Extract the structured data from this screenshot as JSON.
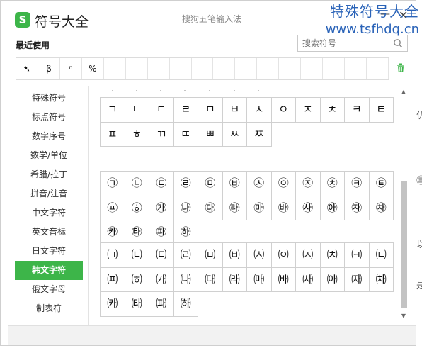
{
  "app": {
    "logo_letter": "S",
    "title": "符号大全",
    "ime_name": "搜狗五笔输入法",
    "minimize": "—",
    "close": "✕"
  },
  "watermark": {
    "title": "特殊符号大全",
    "url": "www.tsfhdq.cn"
  },
  "recent": {
    "label": "最近使用",
    "items": [
      "➷",
      "β",
      "ⁿ",
      "%",
      "",
      "",
      "",
      "",
      "",
      "",
      "",
      "",
      "",
      "",
      "",
      "",
      ""
    ]
  },
  "search": {
    "placeholder": "搜索符号"
  },
  "sidebar": {
    "items": [
      {
        "label": "特殊符号",
        "active": false
      },
      {
        "label": "标点符号",
        "active": false
      },
      {
        "label": "数字序号",
        "active": false
      },
      {
        "label": "数学/单位",
        "active": false
      },
      {
        "label": "希腊/拉丁",
        "active": false
      },
      {
        "label": "拼音/注音",
        "active": false
      },
      {
        "label": "中文字符",
        "active": false
      },
      {
        "label": "英文音标",
        "active": false
      },
      {
        "label": "日文字符",
        "active": false
      },
      {
        "label": "韩文字符",
        "active": true
      },
      {
        "label": "俄文字母",
        "active": false
      },
      {
        "label": "制表符",
        "active": false
      }
    ]
  },
  "grid_jamo": [
    [
      "ㄱ",
      "ㄴ",
      "ㄷ",
      "ㄹ",
      "ㅁ",
      "ㅂ",
      "ㅅ",
      "ㅇ",
      "ㅈ",
      "ㅊ",
      "ㅋ",
      "ㅌ"
    ],
    [
      "ㅍ",
      "ㅎ",
      "ㄲ",
      "ㄸ",
      "ㅃ",
      "ㅆ",
      "ㅉ"
    ]
  ],
  "grid_circled": [
    [
      "㉠",
      "㉡",
      "㉢",
      "㉣",
      "㉤",
      "㉥",
      "㉦",
      "㉧",
      "㉨",
      "㉩",
      "㉪",
      "㉫"
    ],
    [
      "㉬",
      "㉭",
      "㉮",
      "㉯",
      "㉰",
      "㉱",
      "㉲",
      "㉳",
      "㉴",
      "㉵",
      "㉶",
      "㉷"
    ],
    [
      "㉸",
      "㉹",
      "㉺",
      "㉻"
    ]
  ],
  "grid_paren": [
    [
      "㈀",
      "㈁",
      "㈂",
      "㈃",
      "㈄",
      "㈅",
      "㈆",
      "㈇",
      "㈈",
      "㈉",
      "㈊",
      "㈋"
    ],
    [
      "㈌",
      "㈍",
      "㈎",
      "㈏",
      "㈐",
      "㈑",
      "㈒",
      "㈓",
      "㈔",
      "㈕",
      "㈖",
      "㈗"
    ],
    [
      "㈘",
      "㈙",
      "㈚",
      "㈛"
    ]
  ],
  "side_peek": [
    "优",
    "㊂",
    "以",
    "是"
  ],
  "colors": {
    "accent": "#3db549",
    "watermark": "#2a63b8"
  }
}
